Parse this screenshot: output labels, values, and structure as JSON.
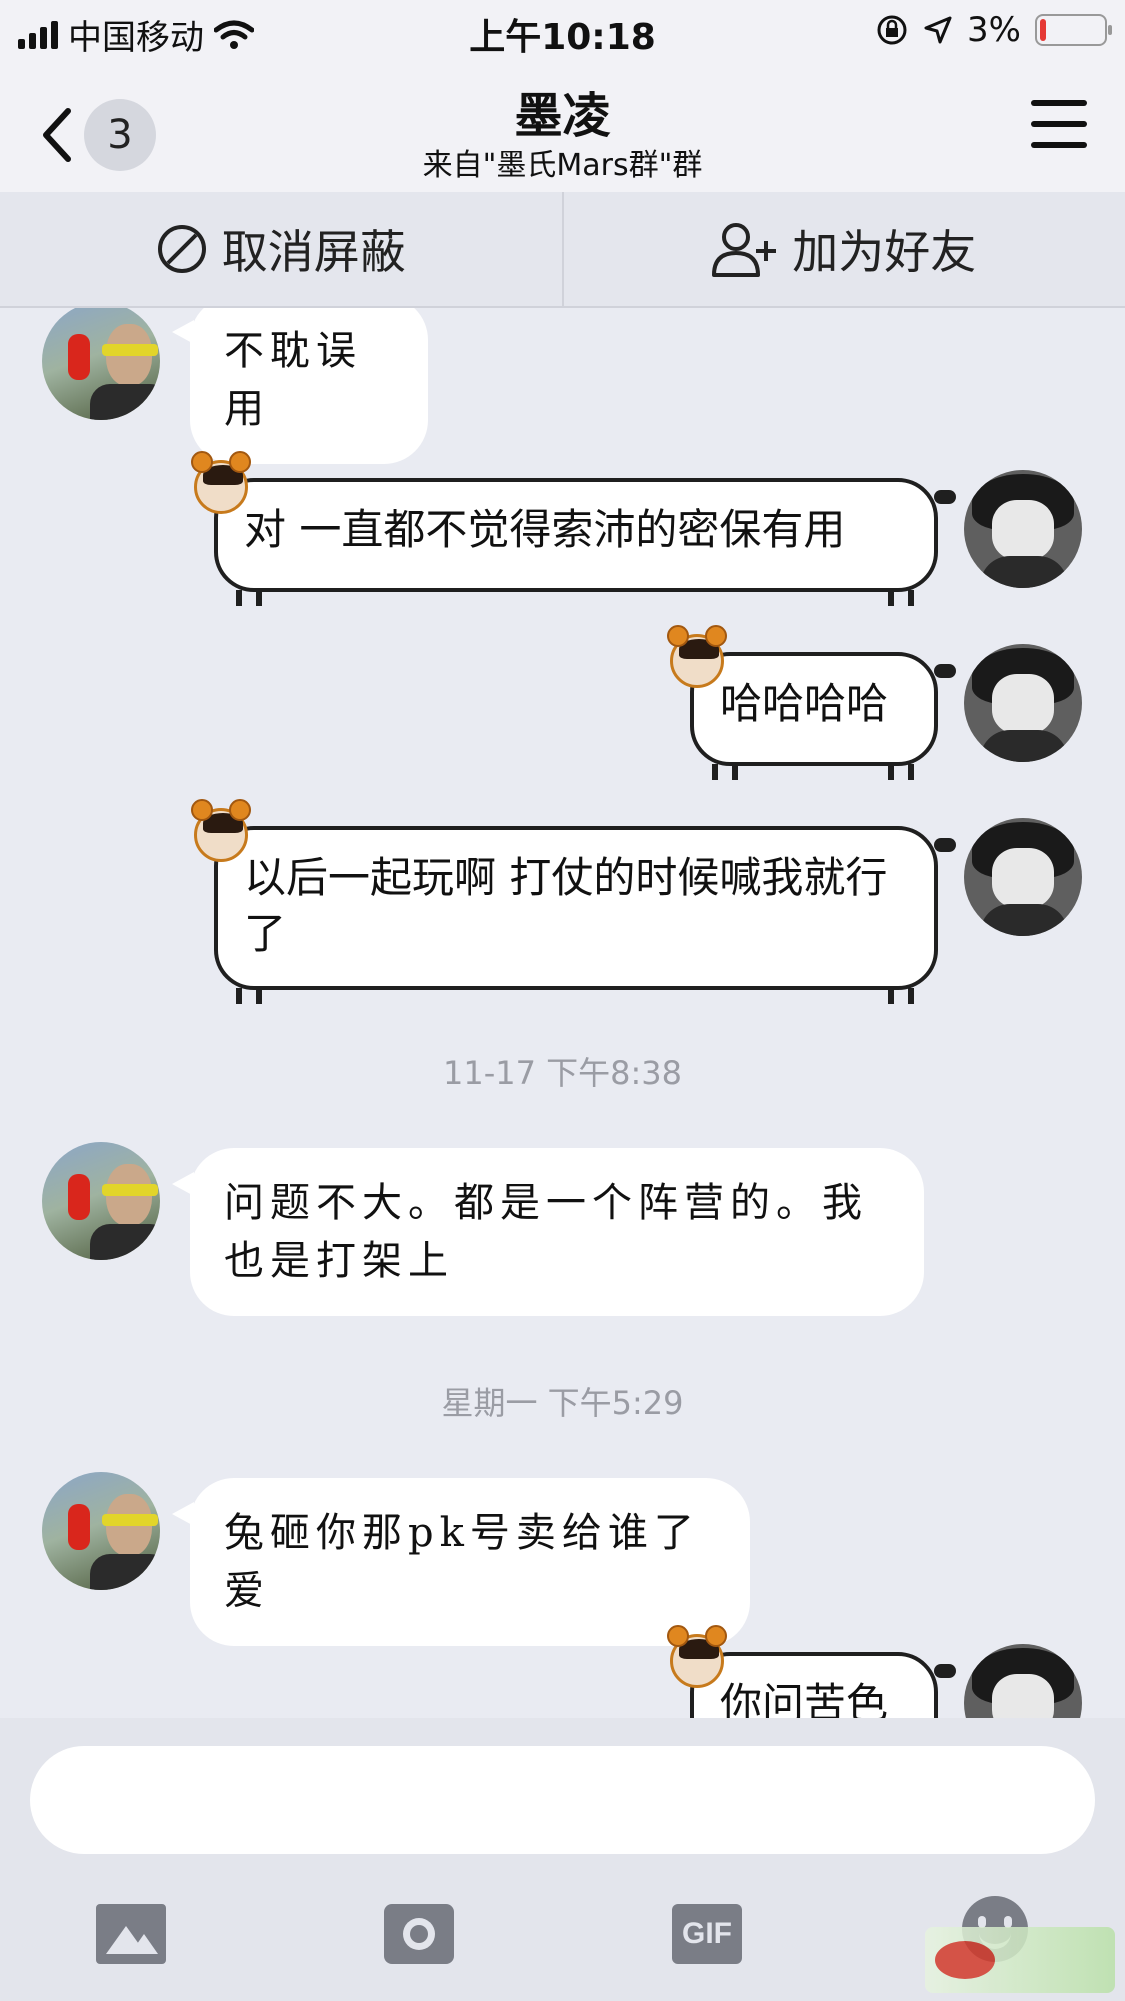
{
  "status_bar": {
    "carrier": "中国移动",
    "time": "上午10:18",
    "battery_percent": "3%",
    "battery_level": 0.03
  },
  "nav": {
    "back_icon": "chevron-left-icon",
    "unread_count": "3",
    "title": "墨凌",
    "subtitle": "来自\"墨氏Mars群\"群",
    "menu_icon": "hamburger-menu-icon"
  },
  "actions": {
    "unblock_label": "取消屏蔽",
    "add_friend_label": "加为好友"
  },
  "messages": [
    {
      "from": "other",
      "text": "不耽误用"
    },
    {
      "from": "me",
      "text": "对 一直都不觉得索沛的密保有用"
    },
    {
      "from": "me",
      "text": "哈哈哈哈"
    },
    {
      "from": "me",
      "text": "以后一起玩啊 打仗的时候喊我就行了"
    },
    {
      "type": "time",
      "text": "11-17 下午8:38"
    },
    {
      "from": "other",
      "text": "问题不大。都是一个阵营的。我也是打架上"
    },
    {
      "type": "time",
      "text": "星期一 下午5:29"
    },
    {
      "from": "other",
      "text": "兔砸你那pk号卖给谁了爱"
    },
    {
      "from": "me",
      "text": "你问苦色"
    }
  ],
  "toolbar": {
    "photo_icon": "photo-icon",
    "camera_icon": "camera-icon",
    "gif_label": "GIF",
    "emoji_icon": "emoji-icon"
  },
  "colors": {
    "background": "#e9ebf2",
    "bubble": "#ffffff",
    "bubble_border": "#1f1f1f",
    "battery_low": "#e53935"
  }
}
